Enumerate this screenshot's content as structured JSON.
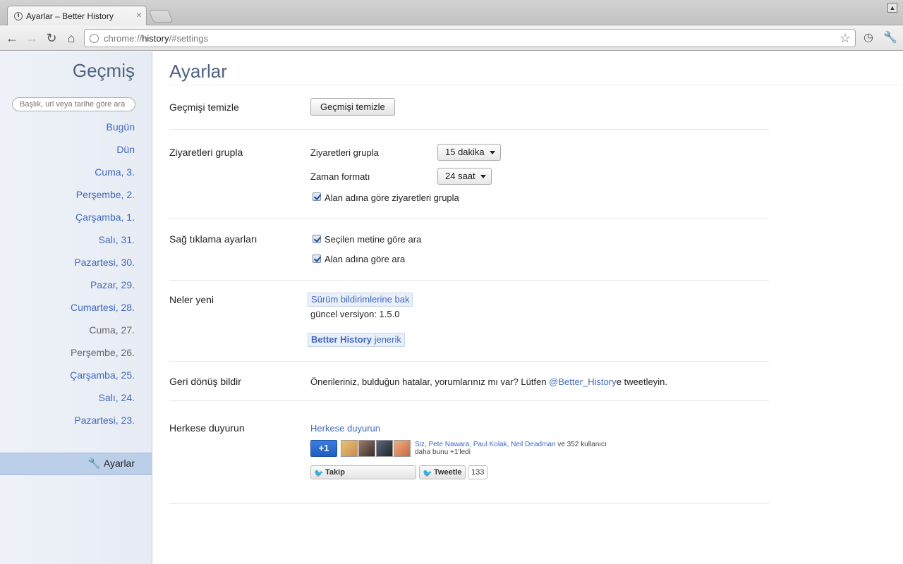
{
  "browser": {
    "tab_title": "Ayarlar – Better History",
    "tab_close": "×",
    "url_scheme": "chrome://",
    "url_host": "history",
    "url_path": "/#settings"
  },
  "sidebar": {
    "title": "Geçmiş",
    "search_placeholder": "Başlık, url veya tarihe göre ara",
    "items": [
      {
        "label": "Bugün",
        "muted": false
      },
      {
        "label": "Dün",
        "muted": false
      },
      {
        "label": "Cuma, 3.",
        "muted": false
      },
      {
        "label": "Perşembe, 2.",
        "muted": false
      },
      {
        "label": "Çarşamba, 1.",
        "muted": false
      },
      {
        "label": "Salı, 31.",
        "muted": false
      },
      {
        "label": "Pazartesi, 30.",
        "muted": false
      },
      {
        "label": "Pazar, 29.",
        "muted": false
      },
      {
        "label": "Cumartesi, 28.",
        "muted": false
      },
      {
        "label": "Cuma, 27.",
        "muted": true
      },
      {
        "label": "Perşembe, 26.",
        "muted": true
      },
      {
        "label": "Çarşamba, 25.",
        "muted": false
      },
      {
        "label": "Salı, 24.",
        "muted": false
      },
      {
        "label": "Pazartesi, 23.",
        "muted": false
      }
    ],
    "settings_label": "Ayarlar"
  },
  "main": {
    "title": "Ayarlar",
    "clear": {
      "label": "Geçmişi temizle",
      "button": "Geçmişi temizle"
    },
    "group": {
      "label": "Ziyaretleri grupla",
      "group_label": "Ziyaretleri grupla",
      "group_value": "15 dakika",
      "time_label": "Zaman formatı",
      "time_value": "24 saat",
      "domain_checkbox": "Alan adına göre ziyaretleri grupla",
      "domain_checked": true
    },
    "rightclick": {
      "label": "Sağ tıklama ayarları",
      "selected_text": "Seçilen metine göre ara",
      "selected_checked": true,
      "domain": "Alan adına göre ara",
      "domain_checked": true
    },
    "whatsnew": {
      "label": "Neler yeni",
      "release_notes": "Sürüm bildirimlerine bak",
      "version": "güncel versiyon: 1.5.0",
      "credits_bold": "Better History",
      "credits_rest": " jenerik"
    },
    "feedback": {
      "label": "Geri dönüş bildir",
      "text_before": "Önerileriniz, bulduğun hatalar, yorumlarınız mı var? Lütfen ",
      "handle": "@Better_History",
      "text_after": "e tweetleyin."
    },
    "share": {
      "label": "Herkese duyurun",
      "link": "Herkese duyurun",
      "plusone": "+1",
      "people": "Siz, Pete Nawara, Paul Kolak, Neil Deadman",
      "people_suffix": " ve 352 kullanıcı",
      "plusone_line2": "daha bunu +1'ledi",
      "follow": "Takip",
      "tweet": "Tweetle",
      "tweet_count": "133"
    }
  }
}
